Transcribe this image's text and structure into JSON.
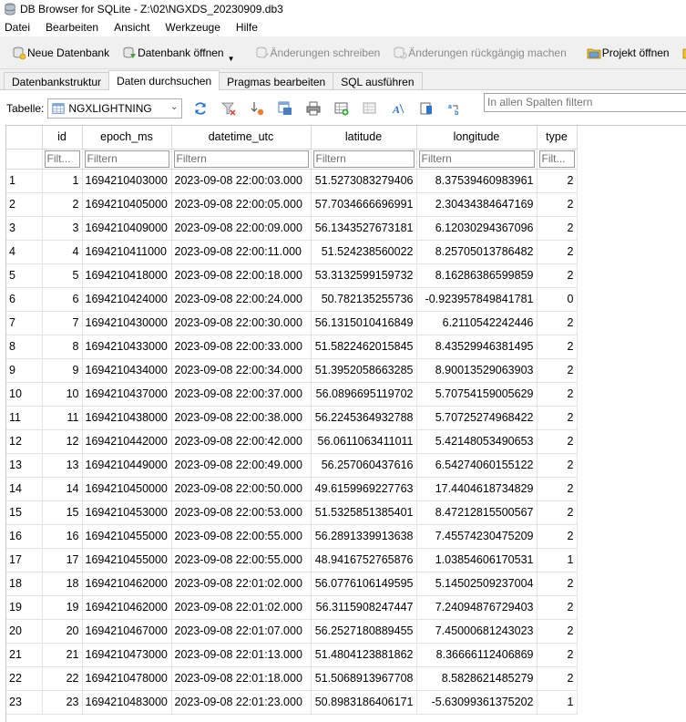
{
  "window": {
    "title": "DB Browser for SQLite - Z:\\02\\NGXDS_20230909.db3"
  },
  "menu": [
    "Datei",
    "Bearbeiten",
    "Ansicht",
    "Werkzeuge",
    "Hilfe"
  ],
  "toolbar": {
    "new_db": "Neue Datenbank",
    "open_db": "Datenbank öffnen",
    "write_changes": "Änderungen schreiben",
    "revert_changes": "Änderungen rückgängig machen",
    "open_project": "Projekt öffnen"
  },
  "tabs": [
    "Datenbankstruktur",
    "Daten durchsuchen",
    "Pragmas bearbeiten",
    "SQL ausführen"
  ],
  "browse": {
    "table_label": "Tabelle:",
    "table_name": "NGXLIGHTNING",
    "global_filter_placeholder": "In allen Spalten filtern"
  },
  "grid": {
    "columns": [
      "id",
      "epoch_ms",
      "datetime_utc",
      "latitude",
      "longitude",
      "type"
    ],
    "filter_placeholders": [
      "Filt...",
      "Filtern",
      "Filtern",
      "Filtern",
      "Filtern",
      "Filt..."
    ],
    "rows": [
      [
        "1",
        "1",
        "1694210403000",
        "2023-09-08 22:00:03.000",
        "51.5273083279406",
        "8.37539460983961",
        "2"
      ],
      [
        "2",
        "2",
        "1694210405000",
        "2023-09-08 22:00:05.000",
        "57.7034666696991",
        "2.30434384647169",
        "2"
      ],
      [
        "3",
        "3",
        "1694210409000",
        "2023-09-08 22:00:09.000",
        "56.1343527673181",
        "6.12030294367096",
        "2"
      ],
      [
        "4",
        "4",
        "1694210411000",
        "2023-09-08 22:00:11.000",
        "51.524238560022",
        "8.25705013786482",
        "2"
      ],
      [
        "5",
        "5",
        "1694210418000",
        "2023-09-08 22:00:18.000",
        "53.3132599159732",
        "8.16286386599859",
        "2"
      ],
      [
        "6",
        "6",
        "1694210424000",
        "2023-09-08 22:00:24.000",
        "50.782135255736",
        "-0.923957849841781",
        "0"
      ],
      [
        "7",
        "7",
        "1694210430000",
        "2023-09-08 22:00:30.000",
        "56.1315010416849",
        "6.2110542242446",
        "2"
      ],
      [
        "8",
        "8",
        "1694210433000",
        "2023-09-08 22:00:33.000",
        "51.5822462015845",
        "8.43529946381495",
        "2"
      ],
      [
        "9",
        "9",
        "1694210434000",
        "2023-09-08 22:00:34.000",
        "51.3952058663285",
        "8.90013529063903",
        "2"
      ],
      [
        "10",
        "10",
        "1694210437000",
        "2023-09-08 22:00:37.000",
        "56.0896695119702",
        "5.70754159005629",
        "2"
      ],
      [
        "11",
        "11",
        "1694210438000",
        "2023-09-08 22:00:38.000",
        "56.2245364932788",
        "5.70725274968422",
        "2"
      ],
      [
        "12",
        "12",
        "1694210442000",
        "2023-09-08 22:00:42.000",
        "56.0611063411011",
        "5.42148053490653",
        "2"
      ],
      [
        "13",
        "13",
        "1694210449000",
        "2023-09-08 22:00:49.000",
        "56.257060437616",
        "6.54274060155122",
        "2"
      ],
      [
        "14",
        "14",
        "1694210450000",
        "2023-09-08 22:00:50.000",
        "49.6159969227763",
        "17.4404618734829",
        "2"
      ],
      [
        "15",
        "15",
        "1694210453000",
        "2023-09-08 22:00:53.000",
        "51.5325851385401",
        "8.47212815500567",
        "2"
      ],
      [
        "16",
        "16",
        "1694210455000",
        "2023-09-08 22:00:55.000",
        "56.2891339913638",
        "7.45574230475209",
        "2"
      ],
      [
        "17",
        "17",
        "1694210455000",
        "2023-09-08 22:00:55.000",
        "48.9416752765876",
        "1.03854606170531",
        "1"
      ],
      [
        "18",
        "18",
        "1694210462000",
        "2023-09-08 22:01:02.000",
        "56.0776106149595",
        "5.14502509237004",
        "2"
      ],
      [
        "19",
        "19",
        "1694210462000",
        "2023-09-08 22:01:02.000",
        "56.3115908247447",
        "7.24094876729403",
        "2"
      ],
      [
        "20",
        "20",
        "1694210467000",
        "2023-09-08 22:01:07.000",
        "56.2527180889455",
        "7.45000681243023",
        "2"
      ],
      [
        "21",
        "21",
        "1694210473000",
        "2023-09-08 22:01:13.000",
        "51.4804123881862",
        "8.36666112406869",
        "2"
      ],
      [
        "22",
        "22",
        "1694210478000",
        "2023-09-08 22:01:18.000",
        "51.5068913967708",
        "8.5828621485279",
        "2"
      ],
      [
        "23",
        "23",
        "1694210483000",
        "2023-09-08 22:01:23.000",
        "50.8983186406171",
        "-5.63099361375202",
        "1"
      ]
    ]
  }
}
